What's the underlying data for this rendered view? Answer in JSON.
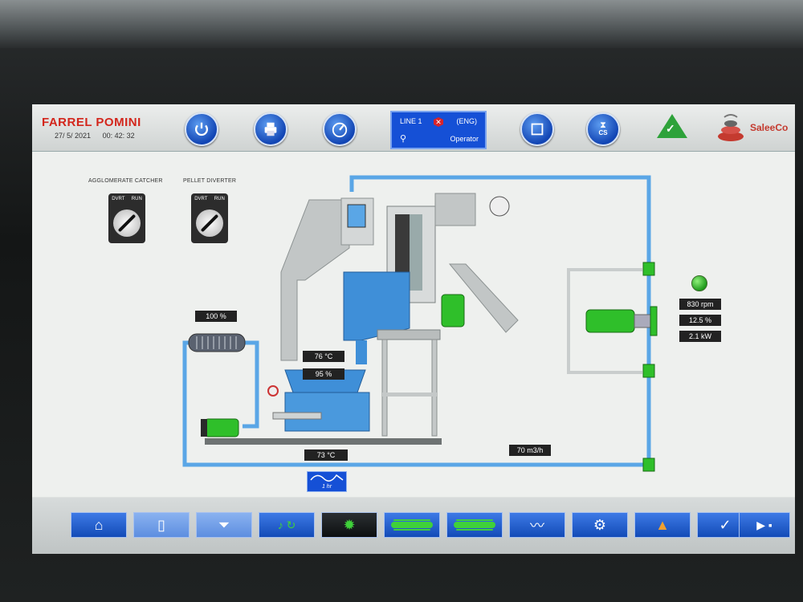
{
  "header": {
    "brand": "FARREL POMINI",
    "date": "27/ 5/ 2021",
    "time": "00: 42: 32",
    "line": "LINE 1",
    "language": "(ENG)",
    "user": "Operator",
    "cs_label": "CS",
    "logo_text": "SaleeCo"
  },
  "selectors": {
    "agglomerate_label": "AGGLOMERATE CATCHER",
    "pellet_label": "PELLET DIVERTER",
    "left_pos": "DVRT",
    "right_pos": "RUN"
  },
  "process": {
    "cooler_pct": "100 %",
    "temp_top": "76 °C",
    "level_pct": "95 %",
    "temp_bottom": "73 °C",
    "flow": "70 m3/h",
    "speed": "830 rpm",
    "load_pct": "12.5 %",
    "power": "2.1 kW",
    "trend_label": "1 hr"
  },
  "colors": {
    "brand_red": "#d3261c",
    "button_blue": "#1550d6",
    "pipe_blue": "#5aa6e6",
    "motor_green": "#2fbf2a",
    "status_green": "#2ea23a"
  },
  "icons": {
    "nav": [
      "home-icon",
      "page-icon",
      "filter-icon",
      "recipe-icon",
      "gear-wheel-icon",
      "pipe-icon",
      "bar-icon",
      "trend-icon",
      "settings-icon",
      "alarm-icon",
      "check-icon",
      "play-page-icon"
    ]
  }
}
